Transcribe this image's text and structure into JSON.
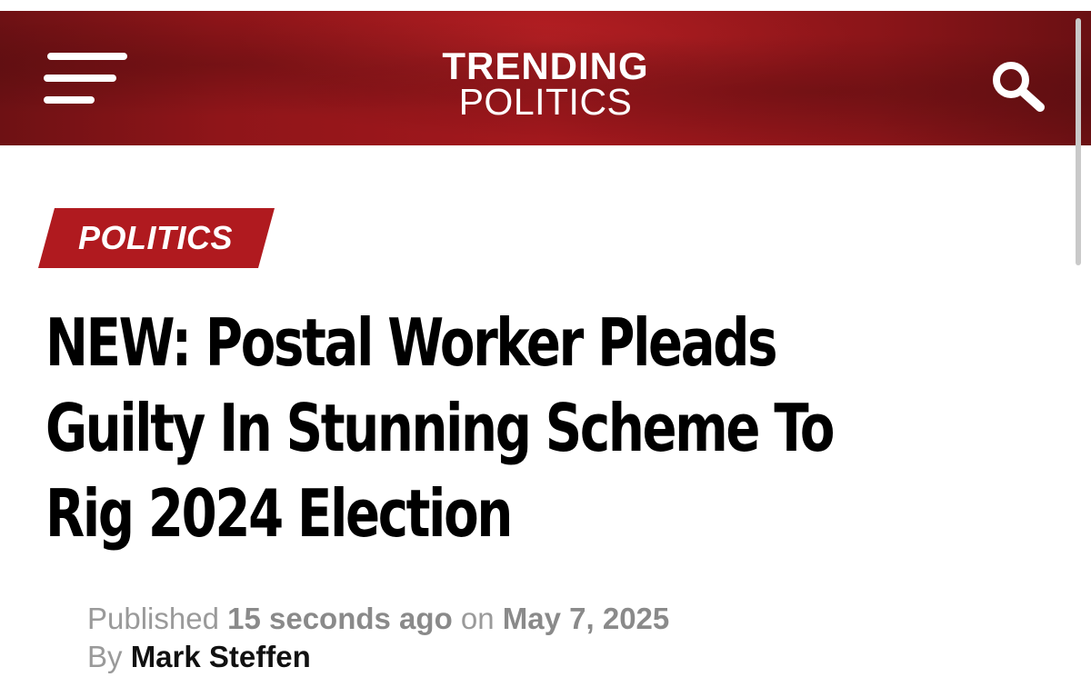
{
  "header": {
    "logo_line1": "TRENDING",
    "logo_line2": "POLITICS",
    "menu_icon": "hamburger-menu-icon",
    "search_icon": "search-icon",
    "colors": {
      "banner": "#a3181d",
      "text": "#ffffff"
    }
  },
  "article": {
    "category": "POLITICS",
    "category_color": "#b01a1f",
    "headline_lines": [
      "NEW: Postal Worker Pleads",
      "Guilty In Stunning Scheme To",
      "Rig 2024 Election"
    ],
    "meta": {
      "published_label": "Published",
      "relative_time": "15 seconds ago",
      "on_label": "on",
      "date": "May 7, 2025",
      "by_label": "By",
      "author": "Mark Steffen"
    }
  }
}
